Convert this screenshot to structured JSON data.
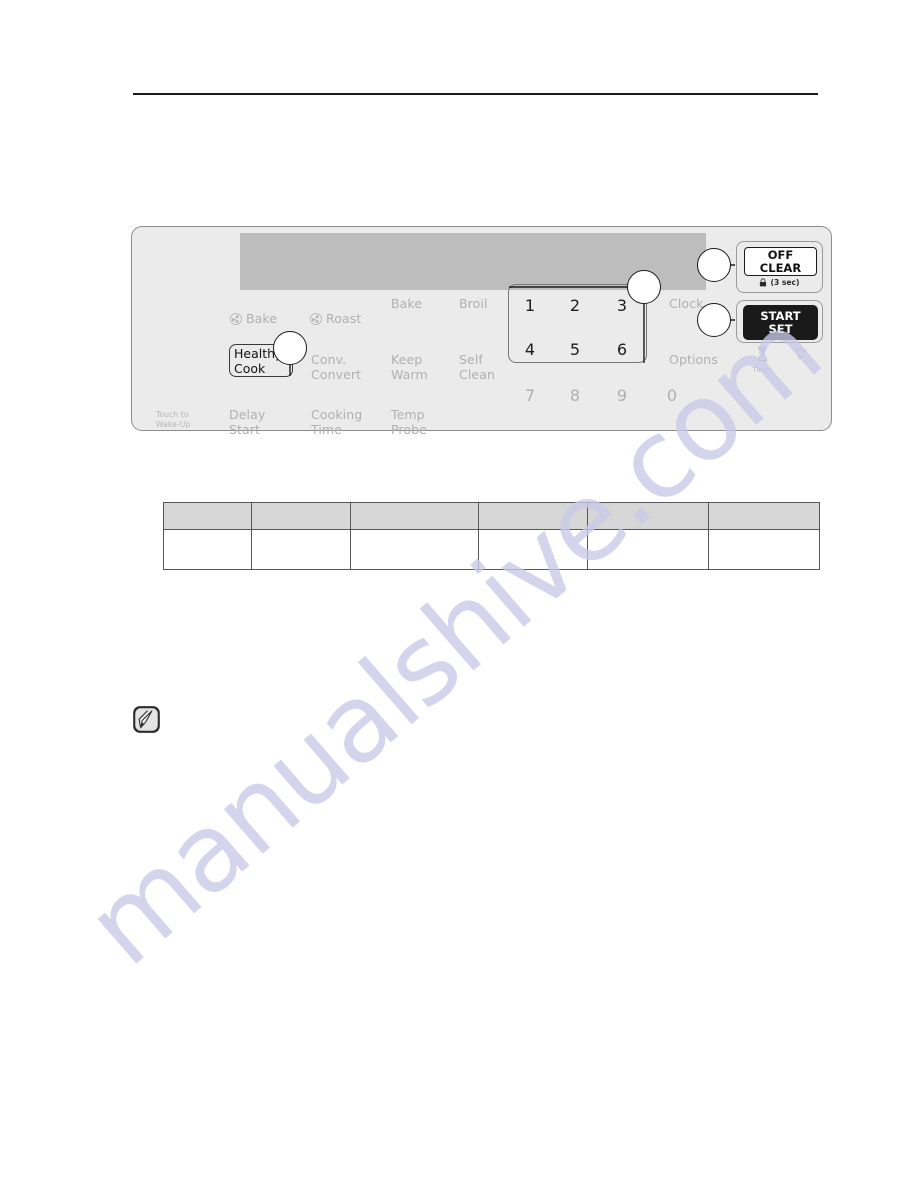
{
  "page": {
    "watermark": "manualshive.com"
  },
  "figure": {
    "name": "oven-control-panel",
    "display": {
      "name": "display-screen",
      "content": ""
    },
    "left_hint": "Touch to\nWake-Up",
    "labels": {
      "conv_bake": "Bake",
      "conv_roast": "Roast",
      "bake": "Bake",
      "broil": "Broil",
      "healthy_cook": "Healthy\nCook",
      "conv_convert": "Conv.\nConvert",
      "keep_warm": "Keep\nWarm",
      "self_clean": "Self\nClean",
      "delay_start": "Delay\nStart",
      "cooking_time": "Cooking\nTime",
      "temp_probe": "Temp\nProbe",
      "clock": "Clock",
      "options": "Options"
    },
    "keypad": {
      "row1": [
        "1",
        "2",
        "3"
      ],
      "row2": [
        "4",
        "5",
        "6"
      ],
      "row3": [
        "7",
        "8",
        "9",
        "0"
      ]
    },
    "buttons": {
      "off_clear": "OFF\nCLEAR",
      "lock_hint": "(3 sec)",
      "lock_icon": "lock-icon",
      "start_set": "START\nSET"
    },
    "indicators": [
      {
        "icon": "hourglass-timer-icon",
        "label": "Timer"
      },
      {
        "icon": "oven-light-icon",
        "label": ""
      }
    ],
    "callouts": [
      {
        "id": "callout-keypad",
        "label": ""
      },
      {
        "id": "callout-healthy-cook",
        "label": ""
      },
      {
        "id": "callout-off-clear",
        "label": ""
      },
      {
        "id": "callout-start-set",
        "label": ""
      }
    ],
    "colors": {
      "panel_bg": "#ebebeb",
      "display_bg": "#bdbdbd",
      "label_gray": "#b0b0b0",
      "active_text": "#1d1d1d",
      "start_button_bg": "#1a1a1a",
      "watermark": "#c9c9e8"
    }
  },
  "table": {
    "name": "spec-table",
    "columns": [
      "",
      "",
      "",
      "",
      "",
      ""
    ],
    "header": [
      "",
      "",
      "",
      "",
      "",
      ""
    ],
    "rows": [
      [
        "",
        "",
        "",
        "",
        "",
        ""
      ]
    ]
  },
  "note": {
    "icon": "note-pen-icon",
    "text": ""
  }
}
